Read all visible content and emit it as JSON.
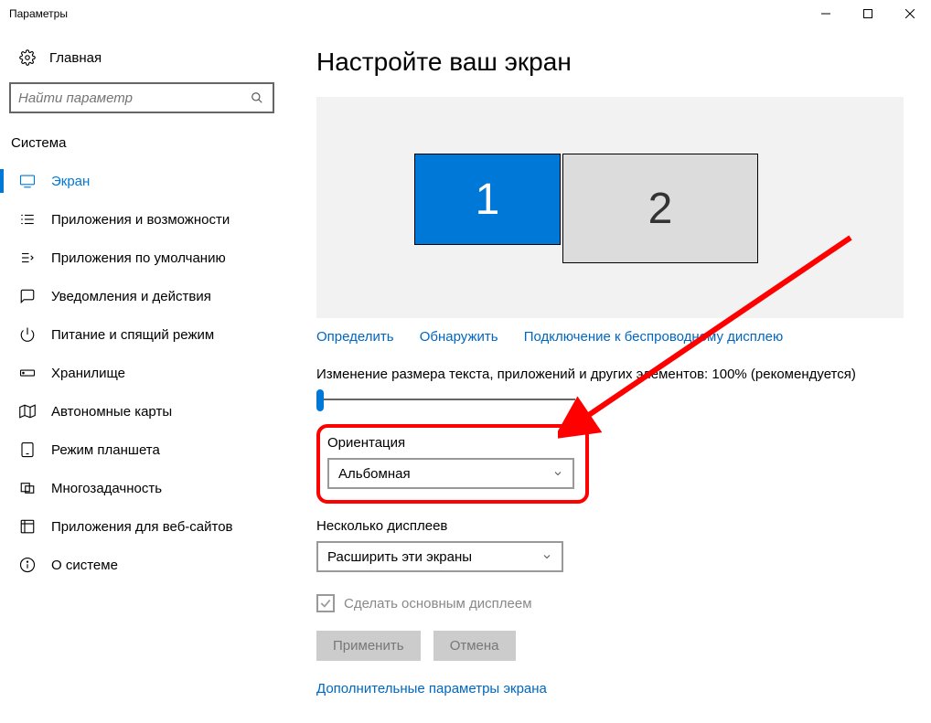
{
  "window": {
    "title": "Параметры"
  },
  "sidebar": {
    "home": "Главная",
    "search_placeholder": "Найти параметр",
    "section": "Система",
    "items": [
      {
        "label": "Экран",
        "icon": "monitor",
        "active": true
      },
      {
        "label": "Приложения и возможности",
        "icon": "list"
      },
      {
        "label": "Приложения по умолчанию",
        "icon": "defaults"
      },
      {
        "label": "Уведомления и действия",
        "icon": "chat"
      },
      {
        "label": "Питание и спящий режим",
        "icon": "power"
      },
      {
        "label": "Хранилище",
        "icon": "storage"
      },
      {
        "label": "Автономные карты",
        "icon": "map"
      },
      {
        "label": "Режим планшета",
        "icon": "tablet"
      },
      {
        "label": "Многозадачность",
        "icon": "multitask"
      },
      {
        "label": "Приложения для веб-сайтов",
        "icon": "webapps"
      },
      {
        "label": "О системе",
        "icon": "info"
      }
    ]
  },
  "main": {
    "title": "Настройте ваш экран",
    "monitors": {
      "m1": "1",
      "m2": "2"
    },
    "links": {
      "identify": "Определить",
      "detect": "Обнаружить",
      "wireless": "Подключение к беспроводному дисплею"
    },
    "scaling_label": "Изменение размера текста, приложений и других элементов: 100% (рекомендуется)",
    "orientation": {
      "label": "Ориентация",
      "value": "Альбомная"
    },
    "multi": {
      "label": "Несколько дисплеев",
      "value": "Расширить эти экраны"
    },
    "main_display_cb": "Сделать основным дисплеем",
    "buttons": {
      "apply": "Применить",
      "cancel": "Отмена"
    },
    "advanced": "Дополнительные параметры экрана"
  }
}
